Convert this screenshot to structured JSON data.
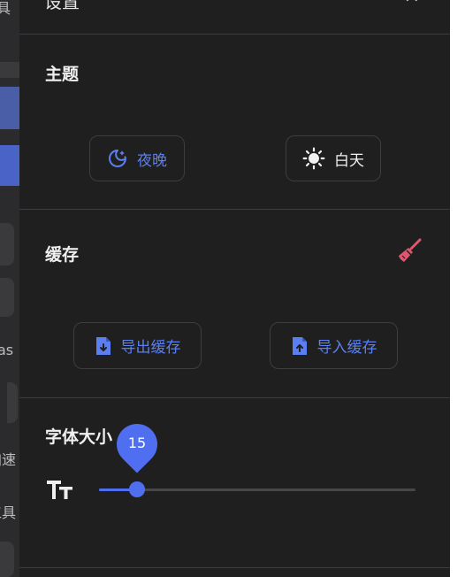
{
  "background_app": {
    "fragments": [
      "具",
      "as",
      "加速",
      "工具"
    ]
  },
  "drawer": {
    "title": "设置",
    "close_symbol": "✕",
    "theme": {
      "title": "主题",
      "night_label": "夜晚",
      "day_label": "白天"
    },
    "cache": {
      "title": "缓存",
      "export_label": "导出缓存",
      "import_label": "导入缓存"
    },
    "font_size": {
      "title": "字体大小",
      "value": "15",
      "slider_fraction": 0.12
    }
  },
  "colors": {
    "accent": "#4f6ff0",
    "panel_bg": "#1f1f20",
    "broom": "#e0566d"
  },
  "icons": {
    "night": "moon-stars-icon",
    "day": "sun-icon",
    "export": "file-download-icon",
    "import": "file-upload-icon",
    "clear_cache": "broom-icon",
    "font_size": "text-size-icon"
  }
}
